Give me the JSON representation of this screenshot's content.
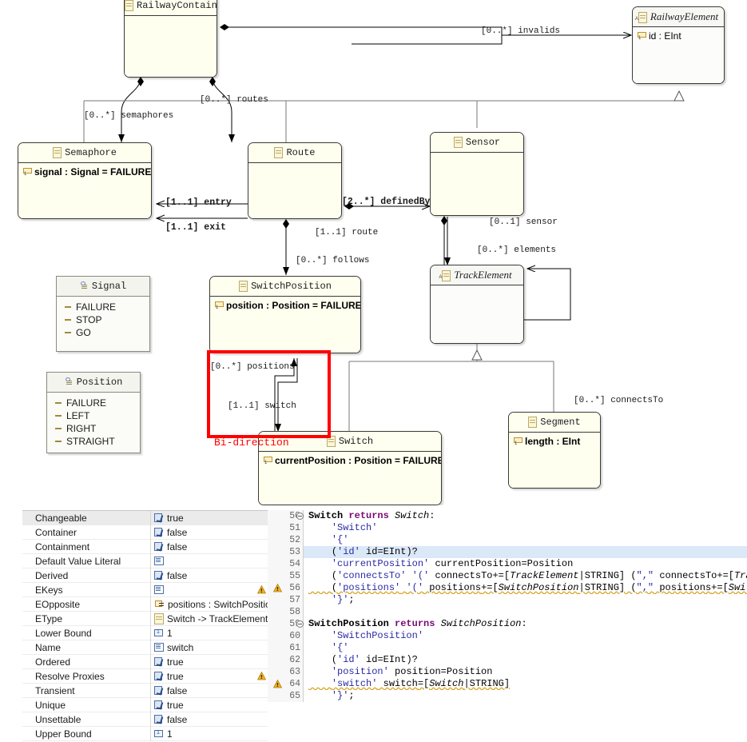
{
  "diagram": {
    "classes": [
      {
        "id": "RailwayContainer",
        "name": "RailwayContainer",
        "abstract": false,
        "attributes": []
      },
      {
        "id": "RailwayElement",
        "name": "RailwayElement",
        "abstract": true,
        "attributes": [
          {
            "text": "id : EInt"
          }
        ]
      },
      {
        "id": "Semaphore",
        "name": "Semaphore",
        "abstract": false,
        "attributes": [
          {
            "text": "signal : Signal = FAILURE"
          }
        ]
      },
      {
        "id": "Route",
        "name": "Route",
        "abstract": false,
        "attributes": []
      },
      {
        "id": "Sensor",
        "name": "Sensor",
        "abstract": false,
        "attributes": []
      },
      {
        "id": "SwitchPosition",
        "name": "SwitchPosition",
        "abstract": false,
        "attributes": [
          {
            "text": "position : Position = FAILURE"
          }
        ]
      },
      {
        "id": "TrackElement",
        "name": "TrackElement",
        "abstract": true,
        "attributes": []
      },
      {
        "id": "Switch",
        "name": "Switch",
        "abstract": false,
        "attributes": [
          {
            "text": "currentPosition : Position = FAILURE"
          }
        ]
      },
      {
        "id": "Segment",
        "name": "Segment",
        "abstract": false,
        "attributes": [
          {
            "text": "length : EInt"
          }
        ]
      }
    ],
    "enums": [
      {
        "id": "Signal",
        "name": "Signal",
        "literals": [
          "FAILURE",
          "STOP",
          "GO"
        ]
      },
      {
        "id": "Position",
        "name": "Position",
        "literals": [
          "FAILURE",
          "LEFT",
          "RIGHT",
          "STRAIGHT"
        ]
      }
    ],
    "edge_labels": [
      {
        "id": "invalids",
        "text": "[0..*] invalids",
        "bold": false
      },
      {
        "id": "routes",
        "text": "[0..*] routes",
        "bold": false
      },
      {
        "id": "semaphores",
        "text": "[0..*] semaphores",
        "bold": false
      },
      {
        "id": "entry",
        "text": "[1..1] entry",
        "bold": true
      },
      {
        "id": "exit",
        "text": "[1..1] exit",
        "bold": true
      },
      {
        "id": "definedBy",
        "text": "[2..*] definedBy",
        "bold": true
      },
      {
        "id": "route",
        "text": "[1..1] route",
        "bold": false
      },
      {
        "id": "sensor",
        "text": "[0..1] sensor",
        "bold": false
      },
      {
        "id": "elements",
        "text": "[0..*] elements",
        "bold": false
      },
      {
        "id": "follows",
        "text": "[0..*] follows",
        "bold": false
      },
      {
        "id": "connectsTo",
        "text": "[0..*] connectsTo",
        "bold": false
      },
      {
        "id": "positions",
        "text": "[0..*] positions",
        "bold": false
      },
      {
        "id": "switch",
        "text": "[1..1] switch",
        "bold": false
      }
    ],
    "annotation": {
      "label": "Bi-direction",
      "color": "#ff0000"
    }
  },
  "properties": {
    "rows": [
      {
        "name": "Changeable",
        "value": "true",
        "icon": "bool",
        "selected": true,
        "warn": false
      },
      {
        "name": "Container",
        "value": "false",
        "icon": "bool",
        "selected": false,
        "warn": false
      },
      {
        "name": "Containment",
        "value": "false",
        "icon": "bool",
        "selected": false,
        "warn": false
      },
      {
        "name": "Default Value Literal",
        "value": "",
        "icon": "text",
        "selected": false,
        "warn": false
      },
      {
        "name": "Derived",
        "value": "false",
        "icon": "bool",
        "selected": false,
        "warn": false
      },
      {
        "name": "EKeys",
        "value": "",
        "icon": "text",
        "selected": false,
        "warn": true
      },
      {
        "name": "EOpposite",
        "value": "positions : SwitchPosition",
        "icon": "ref",
        "selected": false,
        "warn": false
      },
      {
        "name": "EType",
        "value": "Switch -> TrackElement",
        "icon": "etype",
        "selected": false,
        "warn": false
      },
      {
        "name": "Lower Bound",
        "value": "1",
        "icon": "num",
        "selected": false,
        "warn": false
      },
      {
        "name": "Name",
        "value": "switch",
        "icon": "text",
        "selected": false,
        "warn": false
      },
      {
        "name": "Ordered",
        "value": "true",
        "icon": "bool",
        "selected": false,
        "warn": false
      },
      {
        "name": "Resolve Proxies",
        "value": "true",
        "icon": "bool",
        "selected": false,
        "warn": true
      },
      {
        "name": "Transient",
        "value": "false",
        "icon": "bool",
        "selected": false,
        "warn": false
      },
      {
        "name": "Unique",
        "value": "true",
        "icon": "bool",
        "selected": false,
        "warn": false
      },
      {
        "name": "Unsettable",
        "value": "false",
        "icon": "bool",
        "selected": false,
        "warn": false
      },
      {
        "name": "Upper Bound",
        "value": "1",
        "icon": "num",
        "selected": false,
        "warn": false
      }
    ]
  },
  "editor": {
    "lines": [
      {
        "num": "50",
        "text": "Switch returns Switch:",
        "fold": true,
        "warn": false,
        "hl": false,
        "indent": 0
      },
      {
        "num": "51",
        "text": "'Switch'",
        "fold": false,
        "warn": false,
        "hl": false,
        "indent": 1
      },
      {
        "num": "52",
        "text": "'{'",
        "fold": false,
        "warn": false,
        "hl": false,
        "indent": 1
      },
      {
        "num": "53",
        "text": "('id' id=EInt)?",
        "fold": false,
        "warn": false,
        "hl": true,
        "indent": 1
      },
      {
        "num": "54",
        "text": "'currentPosition' currentPosition=Position",
        "fold": false,
        "warn": false,
        "hl": false,
        "indent": 1
      },
      {
        "num": "55",
        "text": "('connectsTo' '(' connectsTo+=[TrackElement|STRING] (\",\" connectsTo+=[Trac",
        "fold": false,
        "warn": false,
        "hl": false,
        "indent": 1
      },
      {
        "num": "56",
        "text": "('positions' '(' positions+=[SwitchPosition|STRING] (\",\" positions+=[Switc",
        "fold": false,
        "warn": true,
        "hl": false,
        "indent": 1
      },
      {
        "num": "57",
        "text": "'}';",
        "fold": false,
        "warn": false,
        "hl": false,
        "indent": 1
      },
      {
        "num": "58",
        "text": "",
        "fold": false,
        "warn": false,
        "hl": false,
        "indent": 0
      },
      {
        "num": "59",
        "text": "SwitchPosition returns SwitchPosition:",
        "fold": true,
        "warn": false,
        "hl": false,
        "indent": 0
      },
      {
        "num": "60",
        "text": "'SwitchPosition'",
        "fold": false,
        "warn": false,
        "hl": false,
        "indent": 1
      },
      {
        "num": "61",
        "text": "'{'",
        "fold": false,
        "warn": false,
        "hl": false,
        "indent": 1
      },
      {
        "num": "62",
        "text": "('id' id=EInt)?",
        "fold": false,
        "warn": false,
        "hl": false,
        "indent": 1
      },
      {
        "num": "63",
        "text": "'position' position=Position",
        "fold": false,
        "warn": false,
        "hl": false,
        "indent": 1
      },
      {
        "num": "64",
        "text": "'switch' switch=[Switch|STRING]",
        "fold": false,
        "warn": true,
        "hl": false,
        "indent": 1
      },
      {
        "num": "65",
        "text": "'}';",
        "fold": false,
        "warn": false,
        "hl": false,
        "indent": 1
      }
    ]
  }
}
